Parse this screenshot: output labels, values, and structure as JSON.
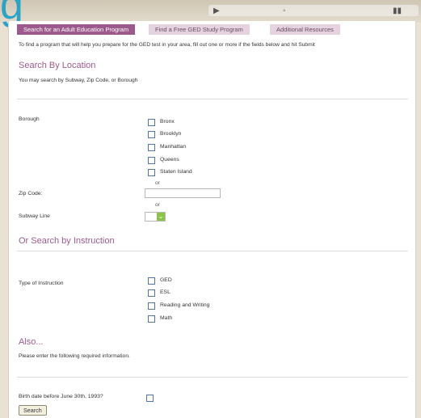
{
  "header_glyph": "g",
  "tabs": [
    {
      "label": "Search for an Adult Education Program",
      "active": true
    },
    {
      "label": "Find a Free GED Study Program",
      "active": false
    },
    {
      "label": "Additional Resources",
      "active": false
    }
  ],
  "intro": "To find a program that will help you prepare for the GED test in your area, fill out one or more if the fields below and hit Submit",
  "location": {
    "title": "Search By Location",
    "sub": "You may search by Subway, Zip Code, or Borough",
    "borough_label": "Borough",
    "boroughs": [
      "Bronx",
      "Brooklyn",
      "Manhattan",
      "Queens",
      "Staten Island"
    ],
    "or1": "or",
    "zip_label": "Zip Code:",
    "zip_value": "",
    "or2": "or",
    "subway_label": "Subway Line"
  },
  "instruction": {
    "title": "Or Search by Instruction",
    "type_label": "Type of Instruction",
    "types": [
      "GED",
      "ESL",
      "Reading and Writing",
      "Math"
    ]
  },
  "also": {
    "title": "Also...",
    "sub": "Please enter the following required information.",
    "birth_label": "Birth date before June 30th, 1993?"
  },
  "search_button": "Search",
  "colors": {
    "accent": "#9c5a8c",
    "checkbox": "#4f76a8",
    "glyph": "#2aa3c7"
  }
}
